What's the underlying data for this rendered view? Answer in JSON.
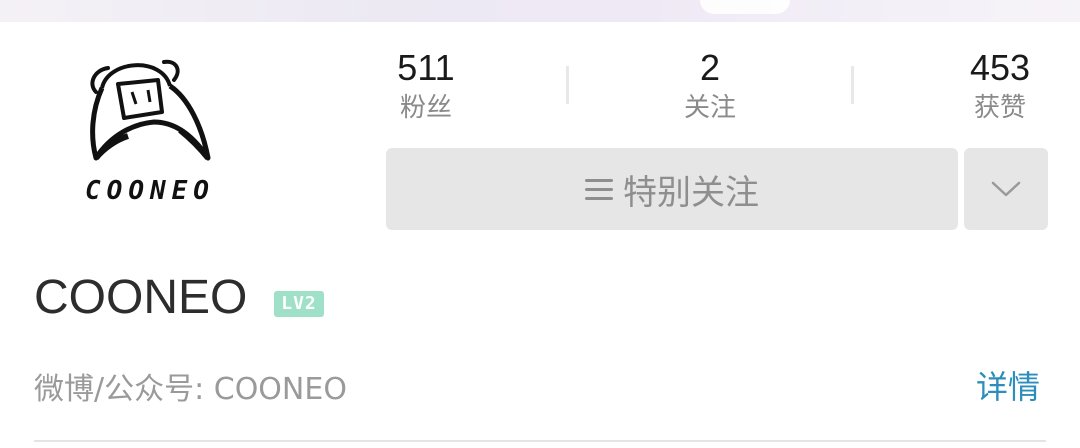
{
  "avatar": {
    "logo_text": "COONEO",
    "icon": "cooneo-logo-icon"
  },
  "stats": [
    {
      "value": "511",
      "label": "粉丝"
    },
    {
      "value": "2",
      "label": "关注"
    },
    {
      "value": "453",
      "label": "获赞"
    }
  ],
  "actions": {
    "special_follow_label": "特别关注",
    "menu_icon": "menu-lines-icon",
    "dropdown_icon": "chevron-down-icon"
  },
  "profile": {
    "name": "COONEO",
    "level": "LV2",
    "bio": "微博/公众号: COONEO",
    "details_label": "详情"
  },
  "colors": {
    "level_badge": "#9ee0c8",
    "link": "#2d8ebd",
    "button_bg": "#e6e6e6"
  }
}
